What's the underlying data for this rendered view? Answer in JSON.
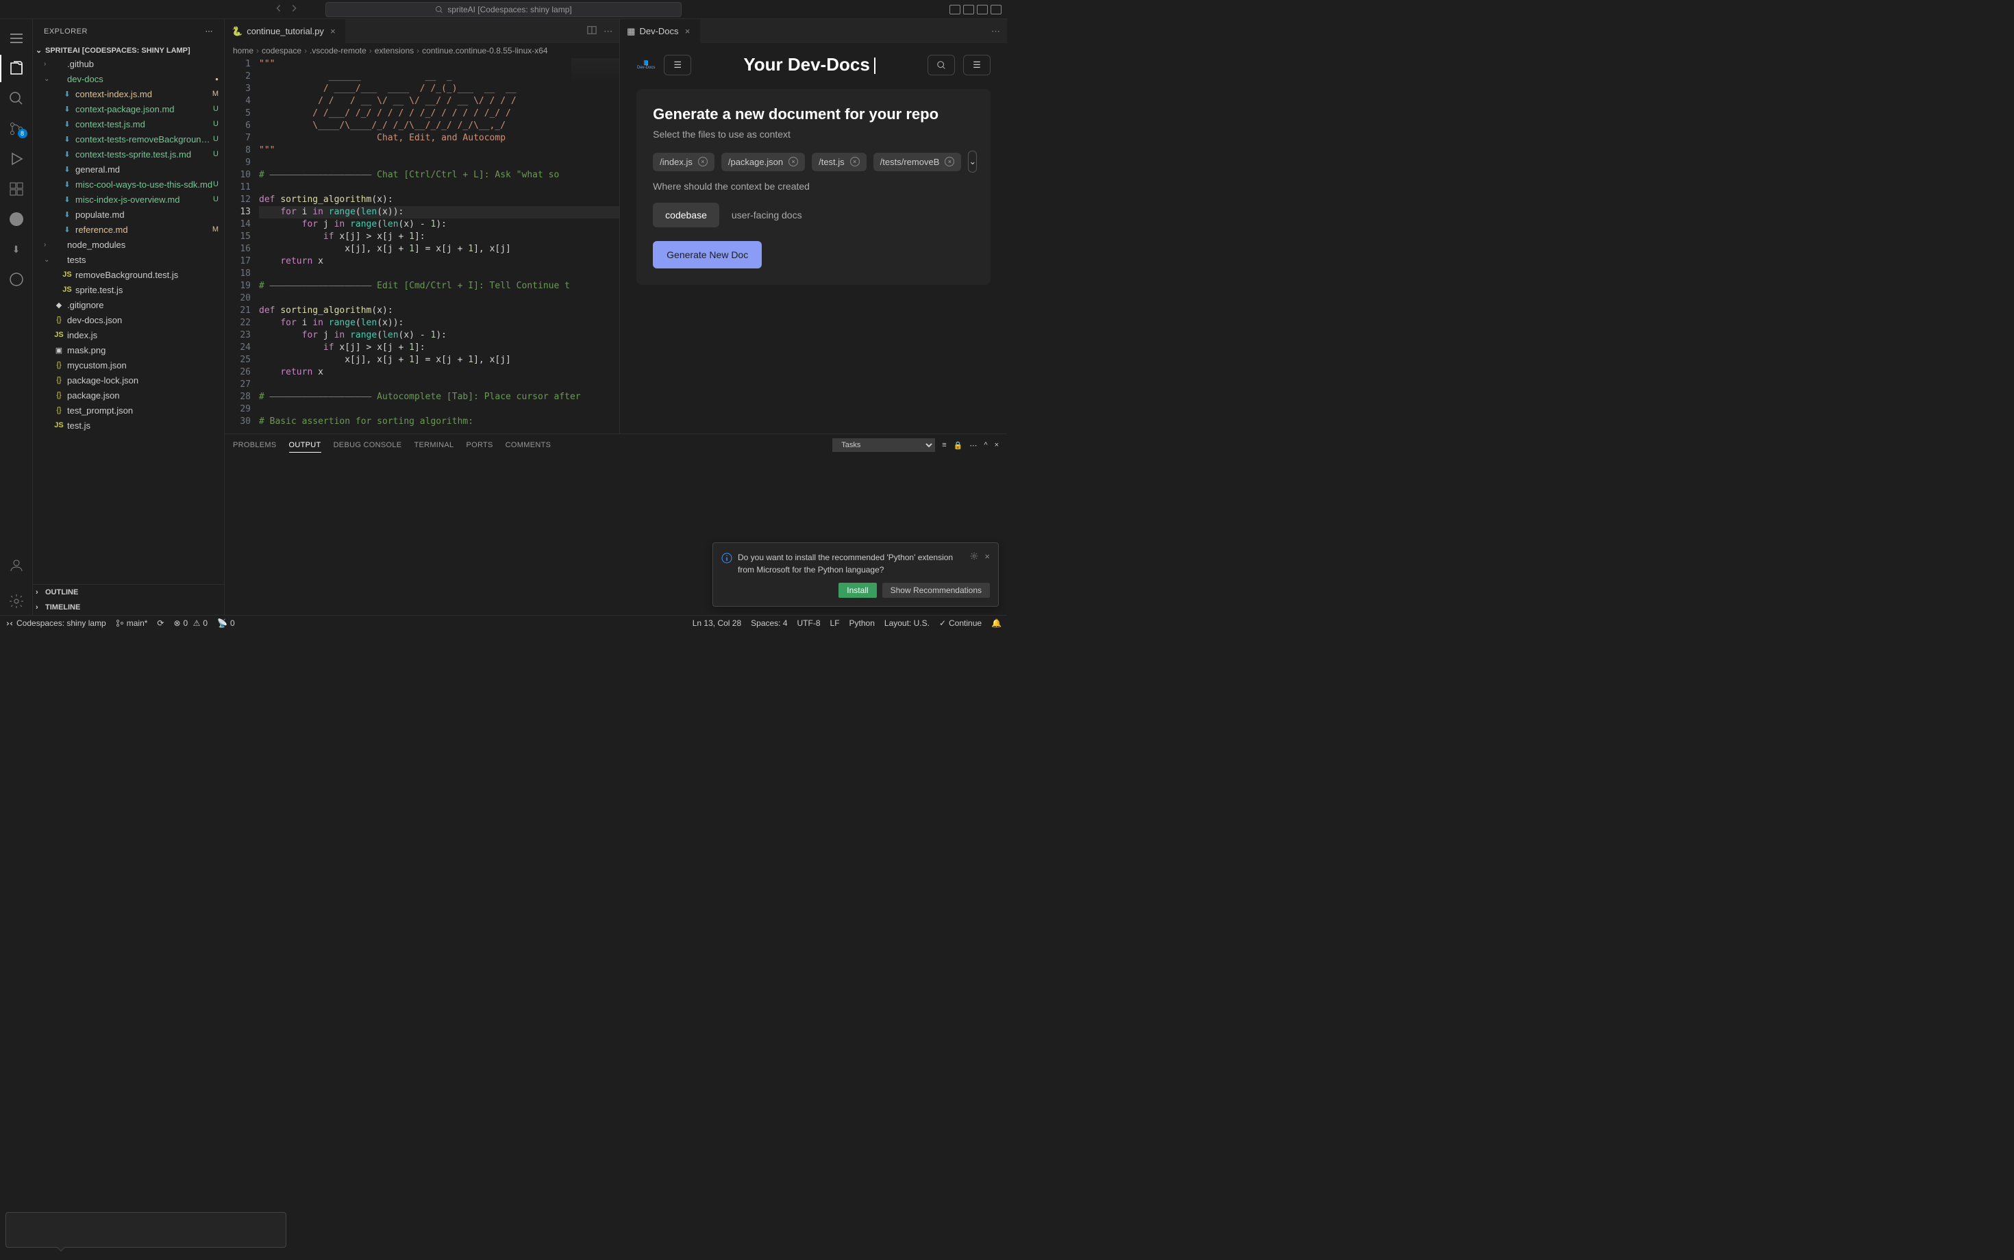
{
  "titlebar": {
    "search": "spriteAI [Codespaces: shiny lamp]"
  },
  "activity": {
    "scm_badge": "8"
  },
  "sidebar": {
    "header": "EXPLORER",
    "workspace": "SPRITEAI [CODESPACES: SHINY LAMP]",
    "outline": "OUTLINE",
    "timeline": "TIMELINE",
    "tree": [
      {
        "label": ".github",
        "type": "folder",
        "chevron": "›",
        "indent": 0,
        "status": ""
      },
      {
        "label": "dev-docs",
        "type": "folder",
        "chevron": "⌄",
        "indent": 0,
        "status": "●",
        "statusClass": "bullet",
        "class": "folder-green"
      },
      {
        "label": "context-index.js.md",
        "type": "file",
        "icon": "⬇",
        "iconClass": "icon-md",
        "indent": 1,
        "status": "M",
        "statusClass": "M",
        "class": "file-modified"
      },
      {
        "label": "context-package.json.md",
        "type": "file",
        "icon": "⬇",
        "iconClass": "icon-md",
        "indent": 1,
        "status": "U",
        "statusClass": "U",
        "class": "file-untracked"
      },
      {
        "label": "context-test.js.md",
        "type": "file",
        "icon": "⬇",
        "iconClass": "icon-md",
        "indent": 1,
        "status": "U",
        "statusClass": "U",
        "class": "file-untracked"
      },
      {
        "label": "context-tests-removeBackground.t…",
        "type": "file",
        "icon": "⬇",
        "iconClass": "icon-md",
        "indent": 1,
        "status": "U",
        "statusClass": "U",
        "class": "file-untracked"
      },
      {
        "label": "context-tests-sprite.test.js.md",
        "type": "file",
        "icon": "⬇",
        "iconClass": "icon-md",
        "indent": 1,
        "status": "U",
        "statusClass": "U",
        "class": "file-untracked"
      },
      {
        "label": "general.md",
        "type": "file",
        "icon": "⬇",
        "iconClass": "icon-md",
        "indent": 1,
        "status": ""
      },
      {
        "label": "misc-cool-ways-to-use-this-sdk.md",
        "type": "file",
        "icon": "⬇",
        "iconClass": "icon-md",
        "indent": 1,
        "status": "U",
        "statusClass": "U",
        "class": "file-untracked"
      },
      {
        "label": "misc-index-js-overview.md",
        "type": "file",
        "icon": "⬇",
        "iconClass": "icon-md",
        "indent": 1,
        "status": "U",
        "statusClass": "U",
        "class": "file-untracked"
      },
      {
        "label": "populate.md",
        "type": "file",
        "icon": "⬇",
        "iconClass": "icon-md",
        "indent": 1,
        "status": ""
      },
      {
        "label": "reference.md",
        "type": "file",
        "icon": "⬇",
        "iconClass": "icon-md",
        "indent": 1,
        "status": "M",
        "statusClass": "M",
        "class": "file-modified"
      },
      {
        "label": "node_modules",
        "type": "folder",
        "chevron": "›",
        "indent": 0,
        "status": ""
      },
      {
        "label": "tests",
        "type": "folder",
        "chevron": "⌄",
        "indent": 0,
        "status": ""
      },
      {
        "label": "removeBackground.test.js",
        "type": "file",
        "icon": "JS",
        "iconClass": "icon-js",
        "indent": 1,
        "status": ""
      },
      {
        "label": "sprite.test.js",
        "type": "file",
        "icon": "JS",
        "iconClass": "icon-js",
        "indent": 1,
        "status": ""
      },
      {
        "label": ".gitignore",
        "type": "file",
        "icon": "◆",
        "iconClass": "",
        "indent": 0,
        "status": ""
      },
      {
        "label": "dev-docs.json",
        "type": "file",
        "icon": "{}",
        "iconClass": "icon-json",
        "indent": 0,
        "status": ""
      },
      {
        "label": "index.js",
        "type": "file",
        "icon": "JS",
        "iconClass": "icon-js",
        "indent": 0,
        "status": ""
      },
      {
        "label": "mask.png",
        "type": "file",
        "icon": "▣",
        "iconClass": "",
        "indent": 0,
        "status": ""
      },
      {
        "label": "mycustom.json",
        "type": "file",
        "icon": "{}",
        "iconClass": "icon-json",
        "indent": 0,
        "status": ""
      },
      {
        "label": "package-lock.json",
        "type": "file",
        "icon": "{}",
        "iconClass": "icon-json",
        "indent": 0,
        "status": ""
      },
      {
        "label": "package.json",
        "type": "file",
        "icon": "{}",
        "iconClass": "icon-json",
        "indent": 0,
        "status": ""
      },
      {
        "label": "test_prompt.json",
        "type": "file",
        "icon": "{}",
        "iconClass": "icon-json",
        "indent": 0,
        "status": ""
      },
      {
        "label": "test.js",
        "type": "file",
        "icon": "JS",
        "iconClass": "icon-js",
        "indent": 0,
        "status": ""
      }
    ]
  },
  "editor": {
    "tab_label": "continue_tutorial.py",
    "tab_icon": "py",
    "breadcrumb": [
      "home",
      "codespace",
      ".vscode-remote",
      "extensions",
      "continue.continue-0.8.55-linux-x64"
    ],
    "lines": [
      {
        "n": 1,
        "html": "<span class='tok-str'>\"\"\"</span>"
      },
      {
        "n": 2,
        "html": "<span class='tok-str'>             ______            __  _</span>"
      },
      {
        "n": 3,
        "html": "<span class='tok-str'>            / ____/___  ____  / /_(_)___  __  __</span>"
      },
      {
        "n": 4,
        "html": "<span class='tok-str'>           / /   / __ \\/ __ \\/ __/ / __ \\/ / / /</span>"
      },
      {
        "n": 5,
        "html": "<span class='tok-str'>          / /___/ /_/ / / / / /_/ / / / / /_/ /</span>"
      },
      {
        "n": 6,
        "html": "<span class='tok-str'>          \\____/\\____/_/ /_/\\__/_/_/ /_/\\__,_/</span>"
      },
      {
        "n": 7,
        "html": "<span class='tok-str'>                      Chat, Edit, and Autocomp</span>"
      },
      {
        "n": 8,
        "html": "<span class='tok-str'>\"\"\"</span>"
      },
      {
        "n": 9,
        "html": ""
      },
      {
        "n": 10,
        "html": "<span class='tok-cm'># ——————————————————— Chat [Ctrl/Ctrl + L]: Ask \"what so</span>"
      },
      {
        "n": 11,
        "html": ""
      },
      {
        "n": 12,
        "html": "<span class='tok-kw'>def</span> <span class='tok-fn'>sorting_algorithm</span>(x):"
      },
      {
        "n": 13,
        "current": true,
        "html": "    <span class='tok-kw'>for</span> i <span class='tok-kw'>in</span> <span class='tok-builtin'>range</span>(<span class='tok-builtin'>len</span>(x)):"
      },
      {
        "n": 14,
        "html": "        <span class='tok-kw'>for</span> j <span class='tok-kw'>in</span> <span class='tok-builtin'>range</span>(<span class='tok-builtin'>len</span>(x) - <span class='tok-num'>1</span>):"
      },
      {
        "n": 15,
        "html": "            <span class='tok-kw'>if</span> x[j] &gt; x[j + <span class='tok-num'>1</span>]:"
      },
      {
        "n": 16,
        "html": "                x[j], x[j + <span class='tok-num'>1</span>] = x[j + <span class='tok-num'>1</span>], x[j]"
      },
      {
        "n": 17,
        "html": "    <span class='tok-kw'>return</span> x"
      },
      {
        "n": 18,
        "html": ""
      },
      {
        "n": 19,
        "html": "<span class='tok-cm'># ——————————————————— Edit [Cmd/Ctrl + I]: Tell Continue t</span>"
      },
      {
        "n": 20,
        "html": ""
      },
      {
        "n": 21,
        "html": "<span class='tok-kw'>def</span> <span class='tok-fn'>sorting_algorithm</span>(x):"
      },
      {
        "n": 22,
        "html": "    <span class='tok-kw'>for</span> i <span class='tok-kw'>in</span> <span class='tok-builtin'>range</span>(<span class='tok-builtin'>len</span>(x)):"
      },
      {
        "n": 23,
        "html": "        <span class='tok-kw'>for</span> j <span class='tok-kw'>in</span> <span class='tok-builtin'>range</span>(<span class='tok-builtin'>len</span>(x) - <span class='tok-num'>1</span>):"
      },
      {
        "n": 24,
        "html": "            <span class='tok-kw'>if</span> x[j] &gt; x[j + <span class='tok-num'>1</span>]:"
      },
      {
        "n": 25,
        "html": "                x[j], x[j + <span class='tok-num'>1</span>] = x[j + <span class='tok-num'>1</span>], x[j]"
      },
      {
        "n": 26,
        "html": "    <span class='tok-kw'>return</span> x"
      },
      {
        "n": 27,
        "html": ""
      },
      {
        "n": 28,
        "html": "<span class='tok-cm'># ——————————————————— Autocomplete [Tab]: Place cursor after</span>"
      },
      {
        "n": 29,
        "html": ""
      },
      {
        "n": 30,
        "html": "<span class='tok-cm'># Basic assertion for sorting algorithm:</span>"
      }
    ]
  },
  "devdocs": {
    "tab_label": "Dev-Docs",
    "logo_text": "Dev-Docs",
    "title": "Your Dev-Docs",
    "card_title": "Generate a new document for your repo",
    "card_sub": "Select the files to use as context",
    "chips": [
      "/index.js",
      "/package.json",
      "/test.js",
      "/tests/removeB"
    ],
    "where_label": "Where should the context be created",
    "toggle_options": [
      "codebase",
      "user-facing docs"
    ],
    "gen_button": "Generate New Doc"
  },
  "panel": {
    "tabs": [
      "PROBLEMS",
      "OUTPUT",
      "DEBUG CONSOLE",
      "TERMINAL",
      "PORTS",
      "COMMENTS"
    ],
    "active": 1,
    "select": "Tasks"
  },
  "notification": {
    "message": "Do you want to install the recommended 'Python' extension from Microsoft for the Python language?",
    "primary": "Install",
    "secondary": "Show Recommendations"
  },
  "statusbar": {
    "codespace": "Codespaces: shiny lamp",
    "branch": "main*",
    "errors": "0",
    "warnings": "0",
    "ports": "0",
    "ln_col": "Ln 13, Col 28",
    "spaces": "Spaces: 4",
    "encoding": "UTF-8",
    "eol": "LF",
    "lang": "Python",
    "layout": "Layout: U.S.",
    "continue": "Continue"
  }
}
